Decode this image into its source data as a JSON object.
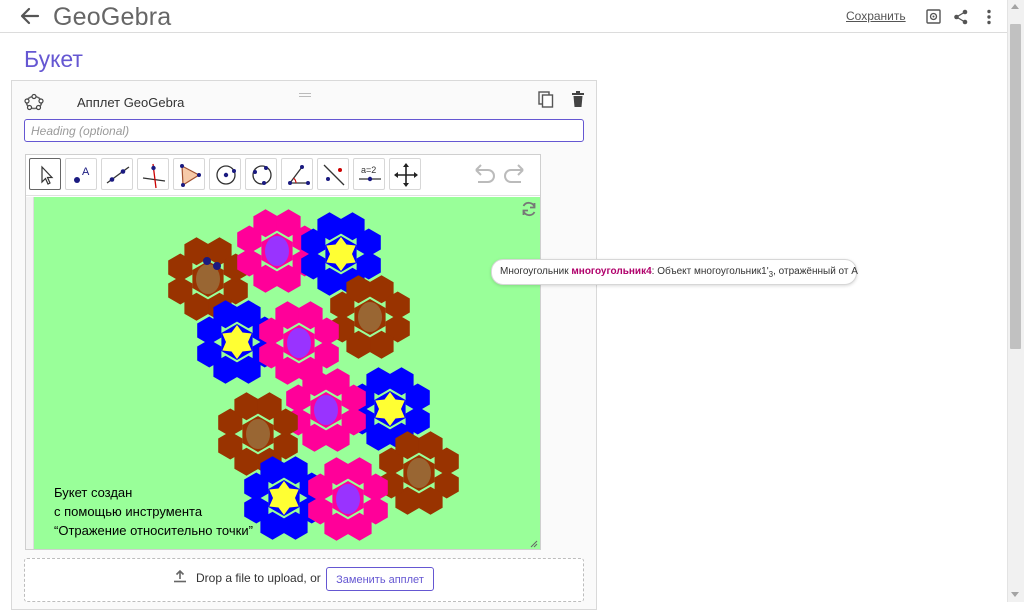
{
  "header": {
    "logo_text": "GeoGebra",
    "save_label": "Сохранить"
  },
  "page": {
    "title": "Букет"
  },
  "card": {
    "label": "Апплет GeoGebra",
    "heading_placeholder": "Heading (optional)"
  },
  "toolbar": {
    "tools": [
      "move-tool",
      "point-tool",
      "line-tool",
      "perpendicular-tool",
      "polygon-tool",
      "circle-tool",
      "circle-3-points-tool",
      "angle-tool",
      "reflect-tool",
      "slider-tool",
      "move-view-tool"
    ],
    "slider_label": "a=2"
  },
  "canvas": {
    "background_color": "#99ff99",
    "text_lines": [
      "Букет создан",
      "с помощью инструмента",
      "“Отражение относительно точки”"
    ],
    "flower_colors": {
      "brown": "#993300",
      "brown_center": "#996633",
      "pink": "#ff0099",
      "pink_center": "#9933ff",
      "blue": "#0000ff",
      "blue_center": "#ffff33"
    }
  },
  "tooltip": {
    "prefix": "Многоугольник ",
    "object_name": "многоугольник4",
    "description": ": Объект многоугольник1",
    "prime": "'",
    "subscript": "3",
    "suffix": ", отражённый от A"
  },
  "upload": {
    "text": "Drop a file to upload, or",
    "replace_label": "Заменить апплет"
  },
  "colors": {
    "accent": "#6557d2",
    "tooltip_highlight": "#b0006b"
  }
}
